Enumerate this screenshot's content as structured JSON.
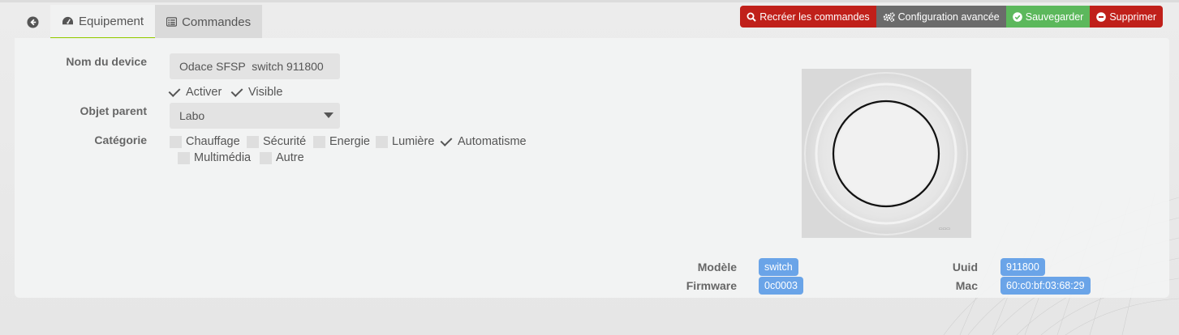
{
  "tabs": {
    "equipement": "Equipement",
    "commandes": "Commandes"
  },
  "actions": {
    "recreate": "Recréer les commandes",
    "advanced": "Configuration avancée",
    "save": "Sauvegarder",
    "delete": "Supprimer"
  },
  "form": {
    "name_label": "Nom du device",
    "name_value": "Odace SFSP  switch 911800",
    "activer": "Activer",
    "visible": "Visible",
    "parent_label": "Objet parent",
    "parent_value": "Labo",
    "category_label": "Catégorie",
    "categories": [
      {
        "label": "Chauffage",
        "checked": false
      },
      {
        "label": "Sécurité",
        "checked": false
      },
      {
        "label": "Energie",
        "checked": false
      },
      {
        "label": "Lumière",
        "checked": false
      },
      {
        "label": "Automatisme",
        "checked": true
      },
      {
        "label": "Multimédia",
        "checked": false
      },
      {
        "label": "Autre",
        "checked": false
      }
    ]
  },
  "info": {
    "modele_label": "Modèle",
    "modele_value": "switch",
    "firmware_label": "Firmware",
    "firmware_value": "0c0003",
    "uuid_label": "Uuid",
    "uuid_value": "911800",
    "mac_label": "Mac",
    "mac_value": "60:c0:bf:03:68:29"
  },
  "colors": {
    "red": "#c0201a",
    "grey": "#6b6b6b",
    "green": "#5cb85c",
    "badge": "#6aa4e8",
    "tab_accent": "#94ca02"
  }
}
